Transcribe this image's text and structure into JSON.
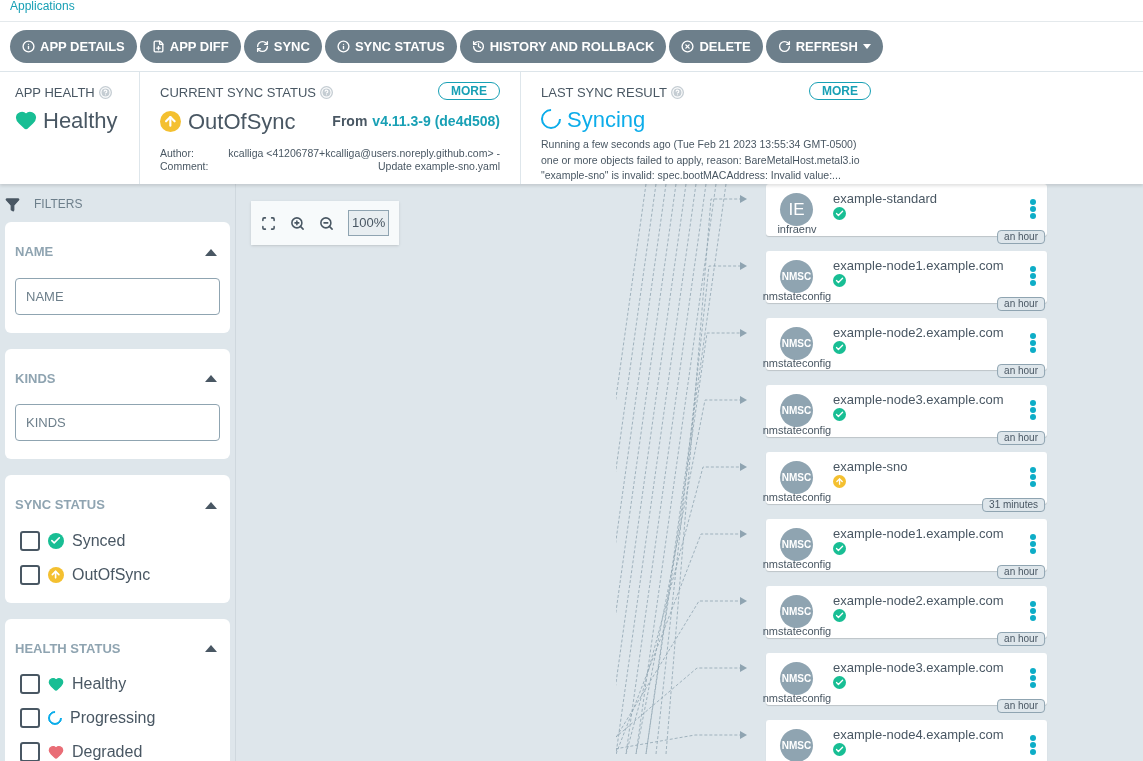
{
  "breadcrumb": [
    "Applications"
  ],
  "toolbar": [
    {
      "label": "APP DETAILS",
      "kind": "info"
    },
    {
      "label": "APP DIFF",
      "kind": "file"
    },
    {
      "label": "SYNC",
      "kind": "sync"
    },
    {
      "label": "SYNC STATUS",
      "kind": "info"
    },
    {
      "label": "HISTORY AND ROLLBACK",
      "kind": "history"
    },
    {
      "label": "DELETE",
      "kind": "delete"
    },
    {
      "label": "REFRESH",
      "kind": "refresh",
      "dropdown": true
    }
  ],
  "app_health": {
    "title": "APP HEALTH",
    "status": "Healthy"
  },
  "current_sync_status": {
    "title": "CURRENT SYNC STATUS",
    "more": "MORE",
    "status": "OutOfSync",
    "from_label": "From",
    "revision": "v4.11.3-9 (de4d508)",
    "author_label": "Author:",
    "author": "kcalliga <41206787+kcalliga@users.noreply.github.com> -",
    "comment_label": "Comment:",
    "comment": "Update example-sno.yaml"
  },
  "last_sync_result": {
    "title": "LAST SYNC RESULT",
    "more": "MORE",
    "status": "Syncing",
    "running": "Running a few seconds ago (Tue Feb 21 2023 13:55:34 GMT-0500)",
    "message": "one or more objects failed to apply, reason: BareMetalHost.metal3.io \"example-sno\" is invalid: spec.bootMACAddress: Invalid value:..."
  },
  "filters": {
    "title": "FILTERS",
    "name": {
      "title": "NAME",
      "placeholder": "NAME"
    },
    "kinds": {
      "title": "KINDS",
      "placeholder": "KINDS"
    },
    "sync_status": {
      "title": "SYNC STATUS",
      "options": [
        {
          "label": "Synced",
          "kind": "synced",
          "checked": false
        },
        {
          "label": "OutOfSync",
          "kind": "outofsync",
          "checked": false
        }
      ]
    },
    "health_status": {
      "title": "HEALTH STATUS",
      "options": [
        {
          "label": "Healthy",
          "kind": "healthy",
          "checked": false
        },
        {
          "label": "Progressing",
          "kind": "progressing",
          "checked": false
        },
        {
          "label": "Degraded",
          "kind": "degraded",
          "checked": false
        }
      ]
    }
  },
  "zoom": {
    "level_text": "100%"
  },
  "nodes": [
    {
      "abbr": "IE",
      "kind": "infraenv",
      "name": "example-standard",
      "synced": true,
      "age": "an hour"
    },
    {
      "abbr": "NMSC",
      "kind": "nmstateconfig",
      "name": "example-node1.example.com",
      "synced": true,
      "age": "an hour"
    },
    {
      "abbr": "NMSC",
      "kind": "nmstateconfig",
      "name": "example-node2.example.com",
      "synced": true,
      "age": "an hour"
    },
    {
      "abbr": "NMSC",
      "kind": "nmstateconfig",
      "name": "example-node3.example.com",
      "synced": true,
      "age": "an hour"
    },
    {
      "abbr": "NMSC",
      "kind": "nmstateconfig",
      "name": "example-sno",
      "synced": false,
      "age": "31 minutes"
    },
    {
      "abbr": "NMSC",
      "kind": "nmstateconfig",
      "name": "example-node1.example.com",
      "synced": true,
      "age": "an hour"
    },
    {
      "abbr": "NMSC",
      "kind": "nmstateconfig",
      "name": "example-node2.example.com",
      "synced": true,
      "age": "an hour"
    },
    {
      "abbr": "NMSC",
      "kind": "nmstateconfig",
      "name": "example-node3.example.com",
      "synced": true,
      "age": "an hour"
    },
    {
      "abbr": "NMSC",
      "name": "example-node4.example.com",
      "synced": true
    }
  ]
}
